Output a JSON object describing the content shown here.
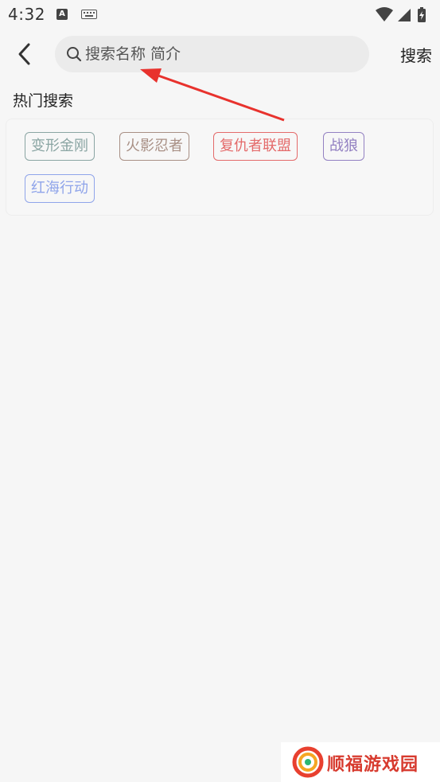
{
  "status_bar": {
    "time": "4:32",
    "a_badge": "A",
    "icons": [
      "a-badge-icon",
      "keyboard-icon",
      "wifi-icon",
      "signal-icon",
      "battery-charging-icon"
    ]
  },
  "header": {
    "search_placeholder": "搜索名称 简介",
    "search_button": "搜索"
  },
  "hot": {
    "title": "热门搜索",
    "tags": [
      {
        "label": "变形金刚",
        "color": "#8aa5a3"
      },
      {
        "label": "火影忍者",
        "color": "#a88f84"
      },
      {
        "label": "复仇者联盟",
        "color": "#e46a6a"
      },
      {
        "label": "战狼",
        "color": "#9381c2"
      },
      {
        "label": "红海行动",
        "color": "#8fa4ea"
      }
    ]
  },
  "watermark": {
    "text": "顺福游戏园"
  },
  "colors": {
    "background": "#f6f6f6",
    "search_bg": "#ebebeb",
    "annotation_arrow": "#e8322d",
    "watermark": "#d73a2e"
  }
}
